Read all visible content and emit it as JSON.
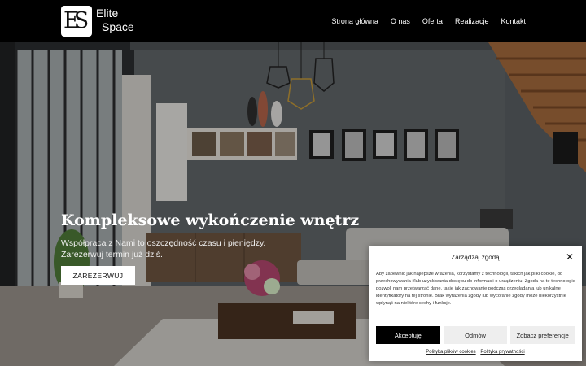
{
  "header": {
    "logo_monogram": "ES",
    "logo_line1": "Elite",
    "logo_line2": "Space",
    "nav": [
      "Strona główna",
      "O nas",
      "Oferta",
      "Realizacje",
      "Kontakt"
    ]
  },
  "hero": {
    "title": "Kompleksowe wykończenie wnętrz",
    "subtitle_line1": "Współpraca z Nami to oszczędność czasu i pieniędzy.",
    "subtitle_line2": "Zarezerwuj termin już dziś.",
    "cta_label": "ZAREZERWUJ"
  },
  "consent": {
    "title": "Zarządzaj zgodą",
    "body": "Aby zapewnić jak najlepsze wrażenia, korzystamy z technologii, takich jak pliki cookie, do przechowywania i/lub uzyskiwania dostępu do informacji o urządzeniu. Zgoda na te technologie pozwoli nam przetwarzać dane, takie jak zachowanie podczas przeglądania lub unikalne identyfikatory na tej stronie. Brak wyrażenia zgody lub wycofanie zgody może niekorzystnie wpłynąć na niektóre cechy i funkcje.",
    "accept_label": "Akceptuję",
    "deny_label": "Odmów",
    "prefs_label": "Zobacz preferencje",
    "cookie_policy_link": "Polityka plików cookies",
    "privacy_policy_link": "Polityka prywatności"
  },
  "colors": {
    "header_bg": "#000000",
    "accept_bg": "#000000",
    "secondary_btn_bg": "#eeeeee"
  }
}
